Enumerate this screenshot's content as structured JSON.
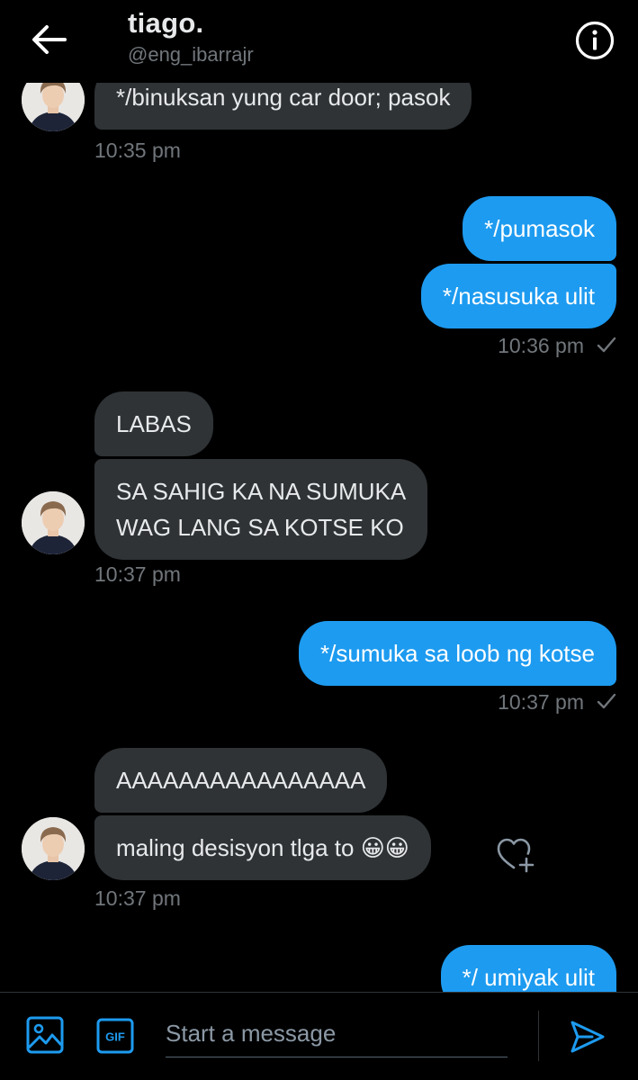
{
  "header": {
    "title": "tiago.",
    "handle": "@eng_ibarrajr"
  },
  "messages": [
    {
      "side": "received",
      "text": "*/binuksan yung car door; pasok"
    },
    {
      "time": "10:35 pm"
    },
    {
      "side": "sent",
      "text": "*/pumasok"
    },
    {
      "side": "sent",
      "text": "*/nasusuka ulit"
    },
    {
      "time": "10:36 pm"
    },
    {
      "side": "received",
      "text": "LABAS"
    },
    {
      "side": "received",
      "lines": [
        "SA SAHIG KA NA SUMUKA",
        "WAG LANG SA KOTSE KO"
      ]
    },
    {
      "time": "10:37 pm"
    },
    {
      "side": "sent",
      "text": "*/sumuka sa loob ng kotse"
    },
    {
      "time": "10:37 pm"
    },
    {
      "side": "received",
      "text": "AAAAAAAAAAAAAAAA"
    },
    {
      "side": "received",
      "text": "maling desisyon tlga to 😀😀"
    },
    {
      "time": "10:37 pm"
    },
    {
      "side": "sent",
      "text": "*/ umiyak ulit"
    }
  ],
  "composer": {
    "placeholder": "Start a message",
    "gif_label": "GIF"
  },
  "colors": {
    "accent": "#1d9bf0",
    "received_bubble": "#2f3336",
    "background": "#000000",
    "muted_text": "#71767b"
  },
  "icons": [
    "back-arrow-icon",
    "info-icon",
    "read-check-icon",
    "heart-plus-icon",
    "image-icon",
    "gif-icon",
    "send-icon"
  ]
}
